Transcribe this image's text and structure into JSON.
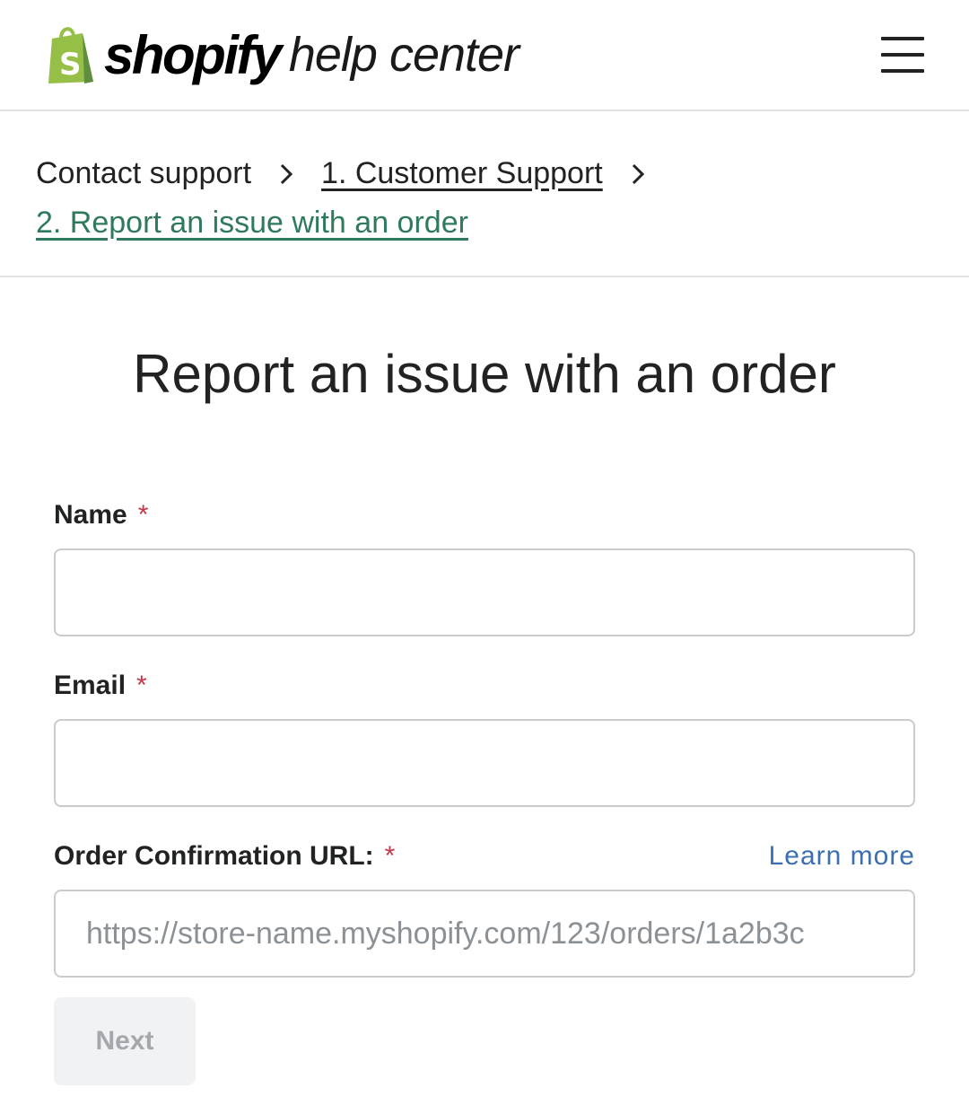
{
  "header": {
    "brand": "shopify",
    "brand_suffix": "help center",
    "logo_color": "#95bf47",
    "menu_icon": "hamburger-menu-icon"
  },
  "breadcrumb": {
    "items": [
      {
        "label": "Contact support"
      },
      {
        "label": "1. Customer Support"
      },
      {
        "label": "2. Report an issue with an order"
      }
    ],
    "separator_icon": "chevron-right-icon",
    "current_color": "#2f7a5c"
  },
  "form": {
    "title": "Report an issue with an order",
    "name": {
      "label": "Name",
      "required_mark": "*",
      "value": ""
    },
    "email": {
      "label": "Email",
      "required_mark": "*",
      "value": ""
    },
    "order_url": {
      "label": "Order Confirmation URL:",
      "required_mark": "*",
      "learn_more": "Learn more",
      "placeholder": "https://store-name.myshopify.com/123/orders/1a2b3c"
    },
    "next_label": "Next"
  }
}
